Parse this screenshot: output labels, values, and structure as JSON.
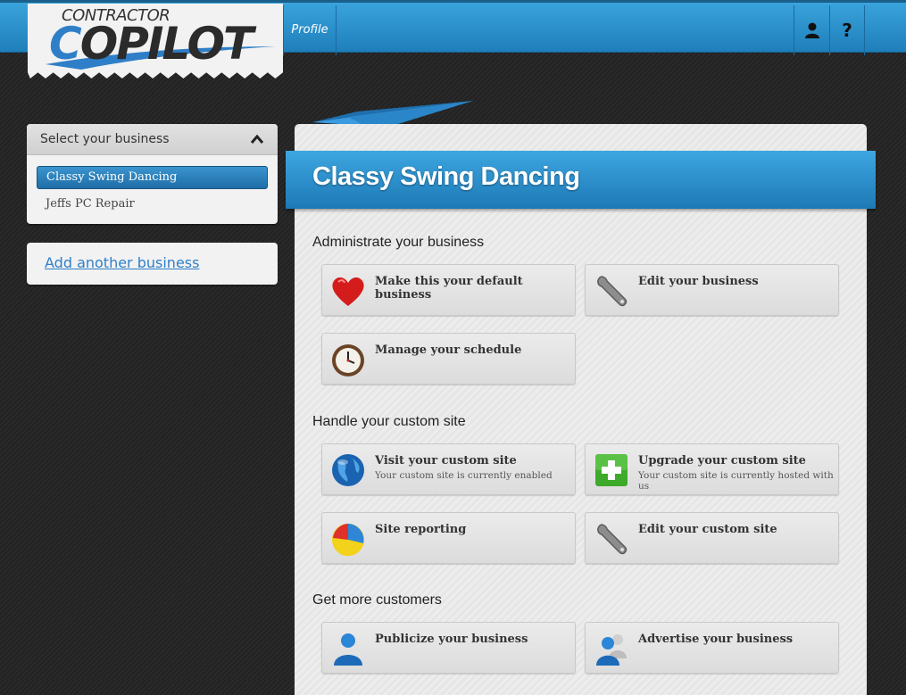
{
  "header": {
    "logo_top": "CONTRACTOR",
    "logo_main_a": "C",
    "logo_main_b": "OPILOT",
    "nav_profile": "Profile",
    "help_label": "?",
    "accent": "#2a8fcf"
  },
  "sidebar": {
    "select_title": "Select your business",
    "businesses": [
      {
        "label": "Classy Swing Dancing",
        "selected": true
      },
      {
        "label": "Jeffs PC Repair",
        "selected": false
      }
    ],
    "add_link": "Add another business"
  },
  "main": {
    "business_name": "Classy Swing Dancing",
    "sections": [
      {
        "title": "Administrate your business",
        "tiles": [
          {
            "title": "Make this your default business",
            "sub": "",
            "icon": "heart-icon"
          },
          {
            "title": "Edit your business",
            "sub": "",
            "icon": "wrench-icon"
          },
          {
            "title": "Manage your schedule",
            "sub": "",
            "icon": "clock-icon"
          }
        ]
      },
      {
        "title": "Handle your custom site",
        "tiles": [
          {
            "title": "Visit your custom site",
            "sub": "Your custom site is currently enabled",
            "icon": "globe-icon"
          },
          {
            "title": "Upgrade your custom site",
            "sub": "Your custom site is currently hosted with us",
            "icon": "plus-icon"
          },
          {
            "title": "Site reporting",
            "sub": "",
            "icon": "pie-chart-icon"
          },
          {
            "title": "Edit your custom site",
            "sub": "",
            "icon": "wrench-icon"
          }
        ]
      },
      {
        "title": "Get more customers",
        "tiles": [
          {
            "title": "Publicize your business",
            "sub": "",
            "icon": "user-icon"
          },
          {
            "title": "Advertise your business",
            "sub": "",
            "icon": "users-icon"
          }
        ]
      }
    ]
  }
}
